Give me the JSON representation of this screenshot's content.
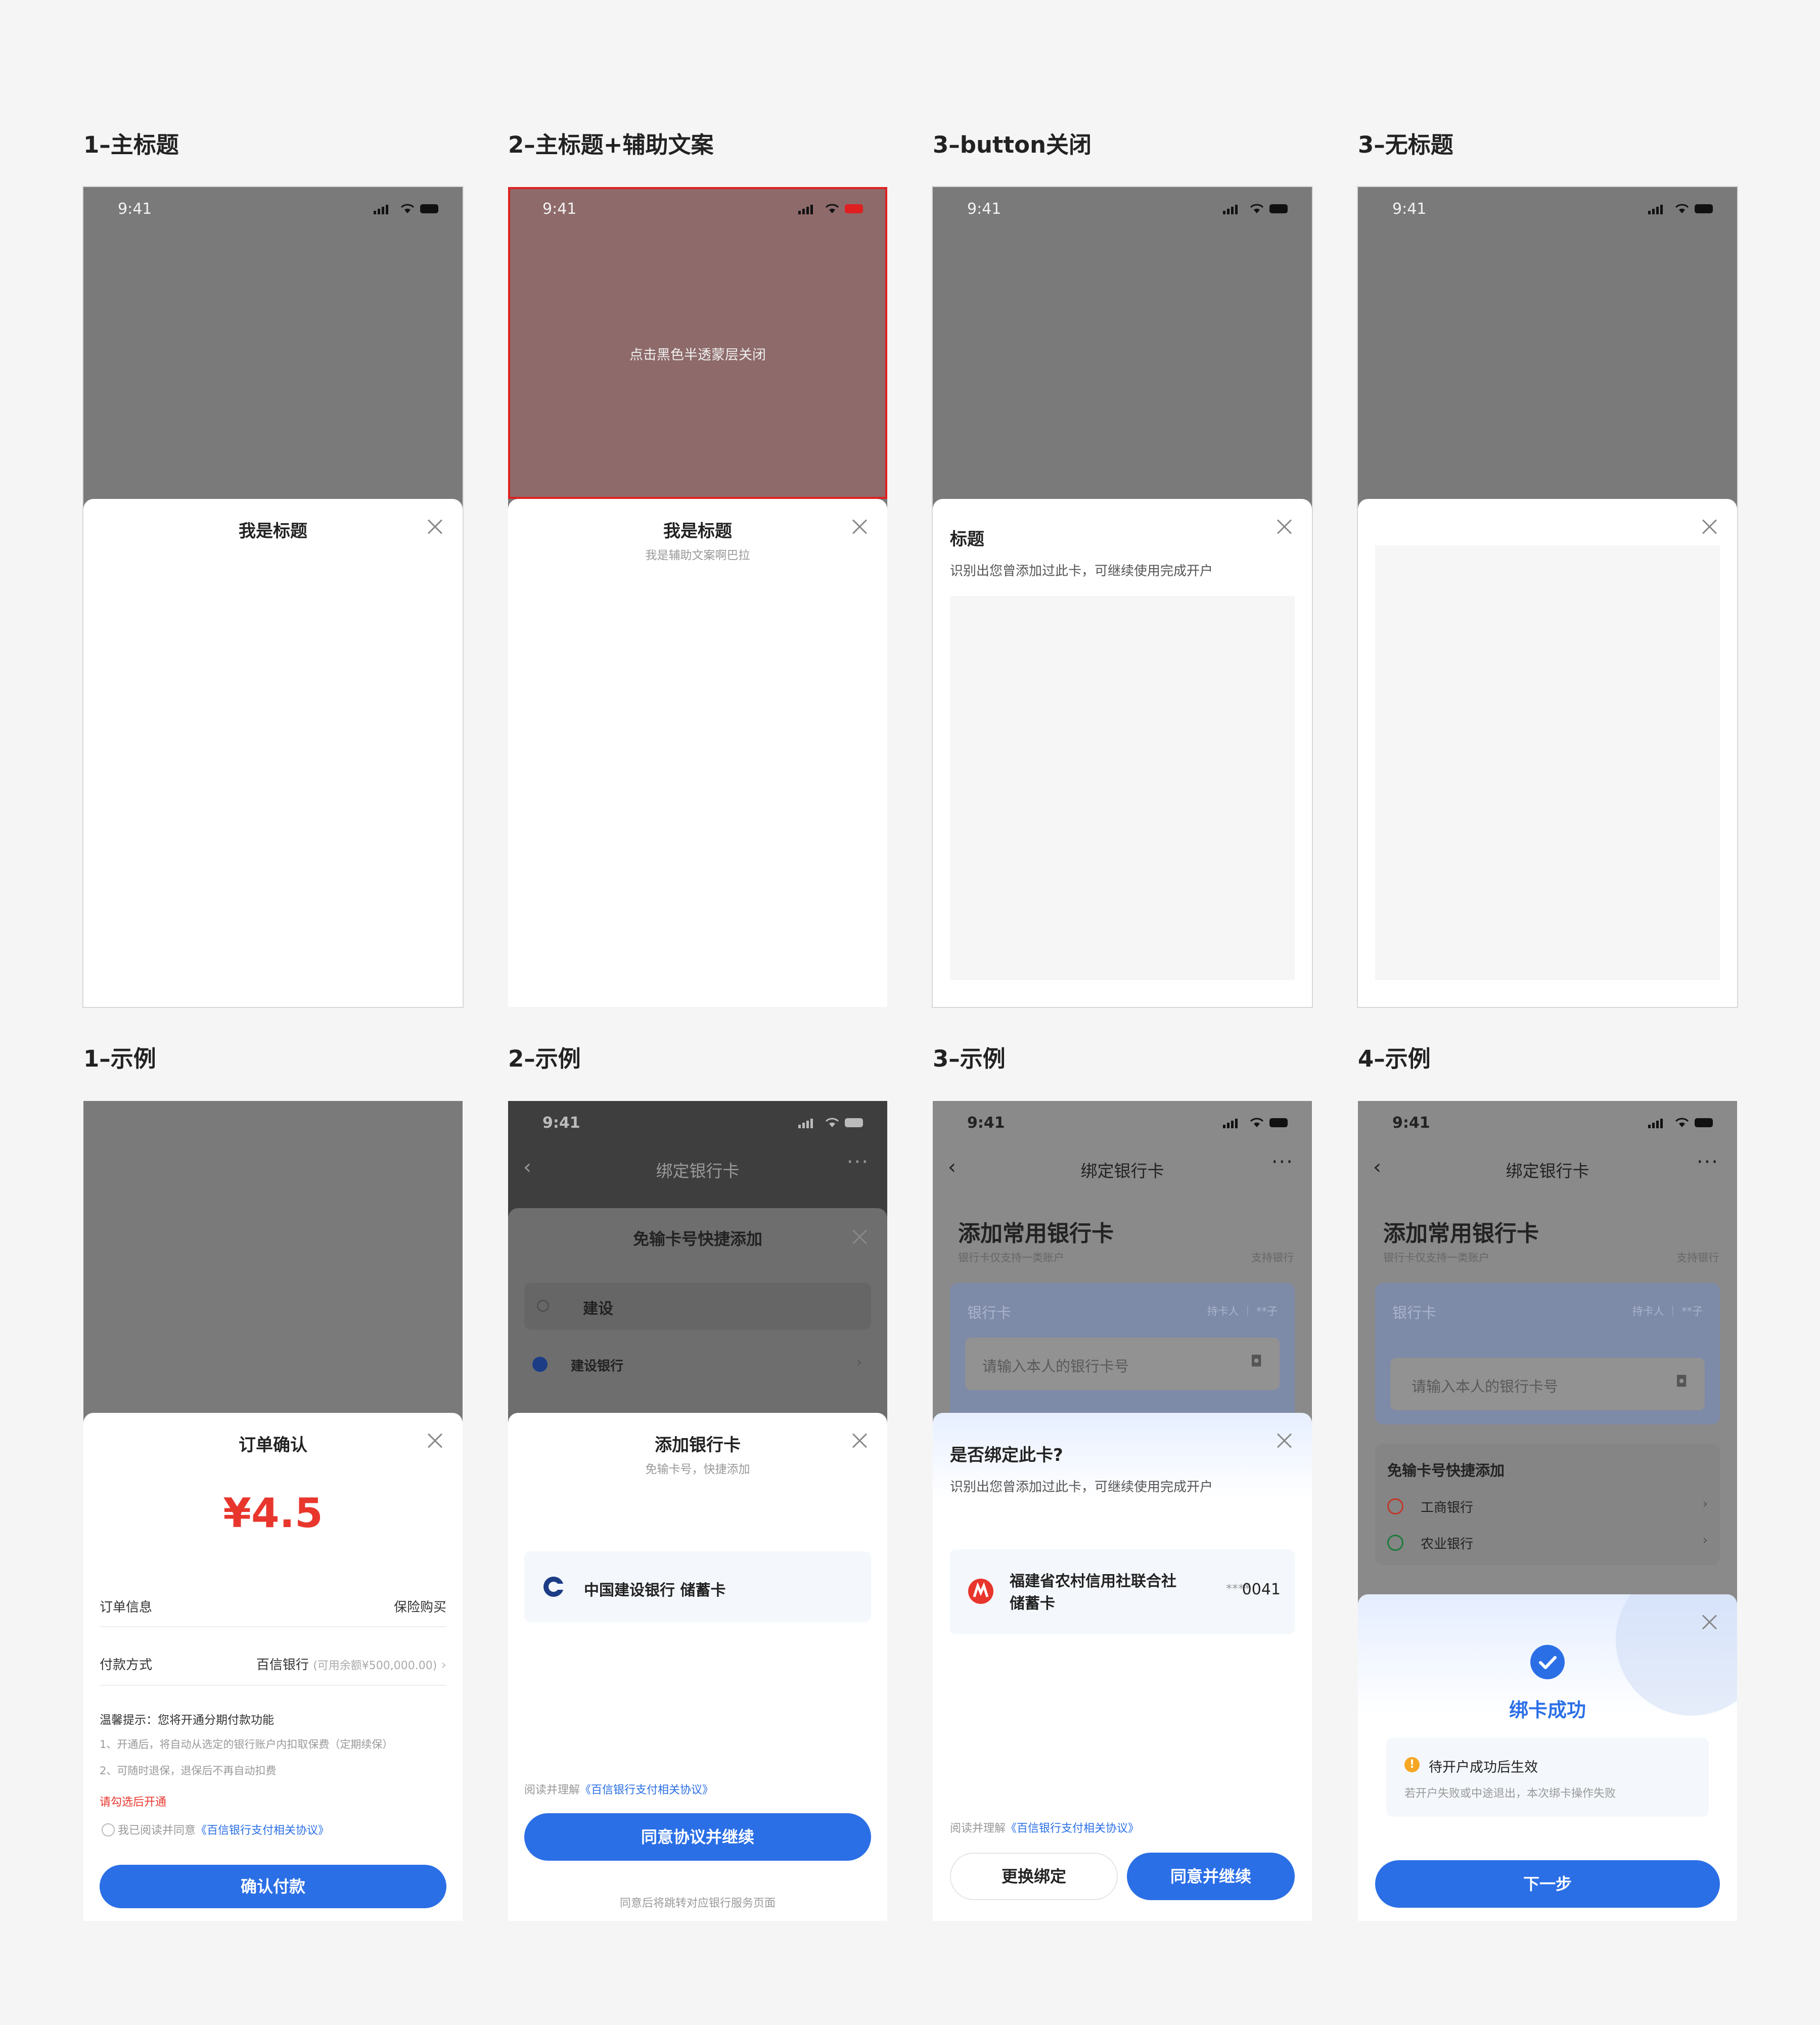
{
  "labels": {
    "p1": "1–主标题",
    "p2": "2–主标题+辅助文案",
    "p3": "3–button关闭",
    "p4": "3–无标题",
    "e1": "1–示例",
    "e2": "2–示例",
    "e3": "3–示例",
    "e4": "4–示例"
  },
  "status_time": "9:41",
  "p1": {
    "title": "我是标题"
  },
  "p2": {
    "overlay_text": "点击黑色半透蒙层关闭",
    "title": "我是标题",
    "subtitle": "我是辅助文案啊巴拉"
  },
  "p3": {
    "title": "标题",
    "desc": "识别出您曾添加过此卡，可继续使用完成开户"
  },
  "e1": {
    "title": "订单确认",
    "amount": "¥4.5",
    "order_label": "订单信息",
    "order_value": "保险购买",
    "pay_label": "付款方式",
    "pay_value": "百信银行",
    "pay_hint": "(可用余额¥500,000.00)",
    "tip_title": "温馨提示：您将开通分期付款功能",
    "tip_1": "1、开通后，将自动从选定的银行账户内扣取保费（定期续保）",
    "tip_2": "2、可随时退保，退保后不再自动扣费",
    "warn": "请勾选后开通",
    "agree_prefix": "我已阅读并同意",
    "agree_link": "《百信银行支付相关协议》",
    "button": "确认付款"
  },
  "e2": {
    "nav_title": "绑定银行卡",
    "bg_title": "免输卡号快捷添加",
    "search_value": "建设",
    "bg_bank": "建设银行",
    "title": "添加银行卡",
    "subtitle": "免输卡号，快捷添加",
    "card": "中国建设银行 储蓄卡",
    "read_prefix": "阅读并理解",
    "read_link": "《百信银行支付相关协议》",
    "button": "同意协议并继续",
    "footer": "同意后将跳转对应银行服务页面"
  },
  "e3": {
    "nav_title": "绑定银行卡",
    "heading": "添加常用银行卡",
    "sub_left": "银行卡仅支持一类账户",
    "sub_right": "支持银行",
    "card_label": "银行卡",
    "holder": "持卡人 ｜ **子",
    "input_placeholder": "请输入本人的银行卡号",
    "title": "是否绑定此卡?",
    "desc": "识别出您曾添加过此卡，可继续使用完成开户",
    "bank_name_1": "福建省农村信用社联合社",
    "bank_name_2": "储蓄卡",
    "mask": "****",
    "last4": "0041",
    "read_prefix": "阅读并理解",
    "read_link": "《百信银行支付相关协议》",
    "btn_left": "更换绑定",
    "btn_right": "同意并继续"
  },
  "e4": {
    "nav_title": "绑定银行卡",
    "heading": "添加常用银行卡",
    "sub_left": "银行卡仅支持一类账户",
    "sub_right": "支持银行",
    "card_label": "银行卡",
    "holder": "持卡人 ｜ **子",
    "input_placeholder": "请输入本人的银行卡号",
    "quick_title": "免输卡号快捷添加",
    "bank_1": "工商银行",
    "bank_2": "农业银行",
    "success": "绑卡成功",
    "notice_title": "待开户成功后生效",
    "notice_desc": "若开户失败或中途退出，本次绑卡操作失败",
    "button": "下一步"
  },
  "colors": {
    "primary": "#2b6fe6",
    "danger": "#e8362d",
    "mask": "#7a7a7a",
    "highlight": "#e02020"
  }
}
